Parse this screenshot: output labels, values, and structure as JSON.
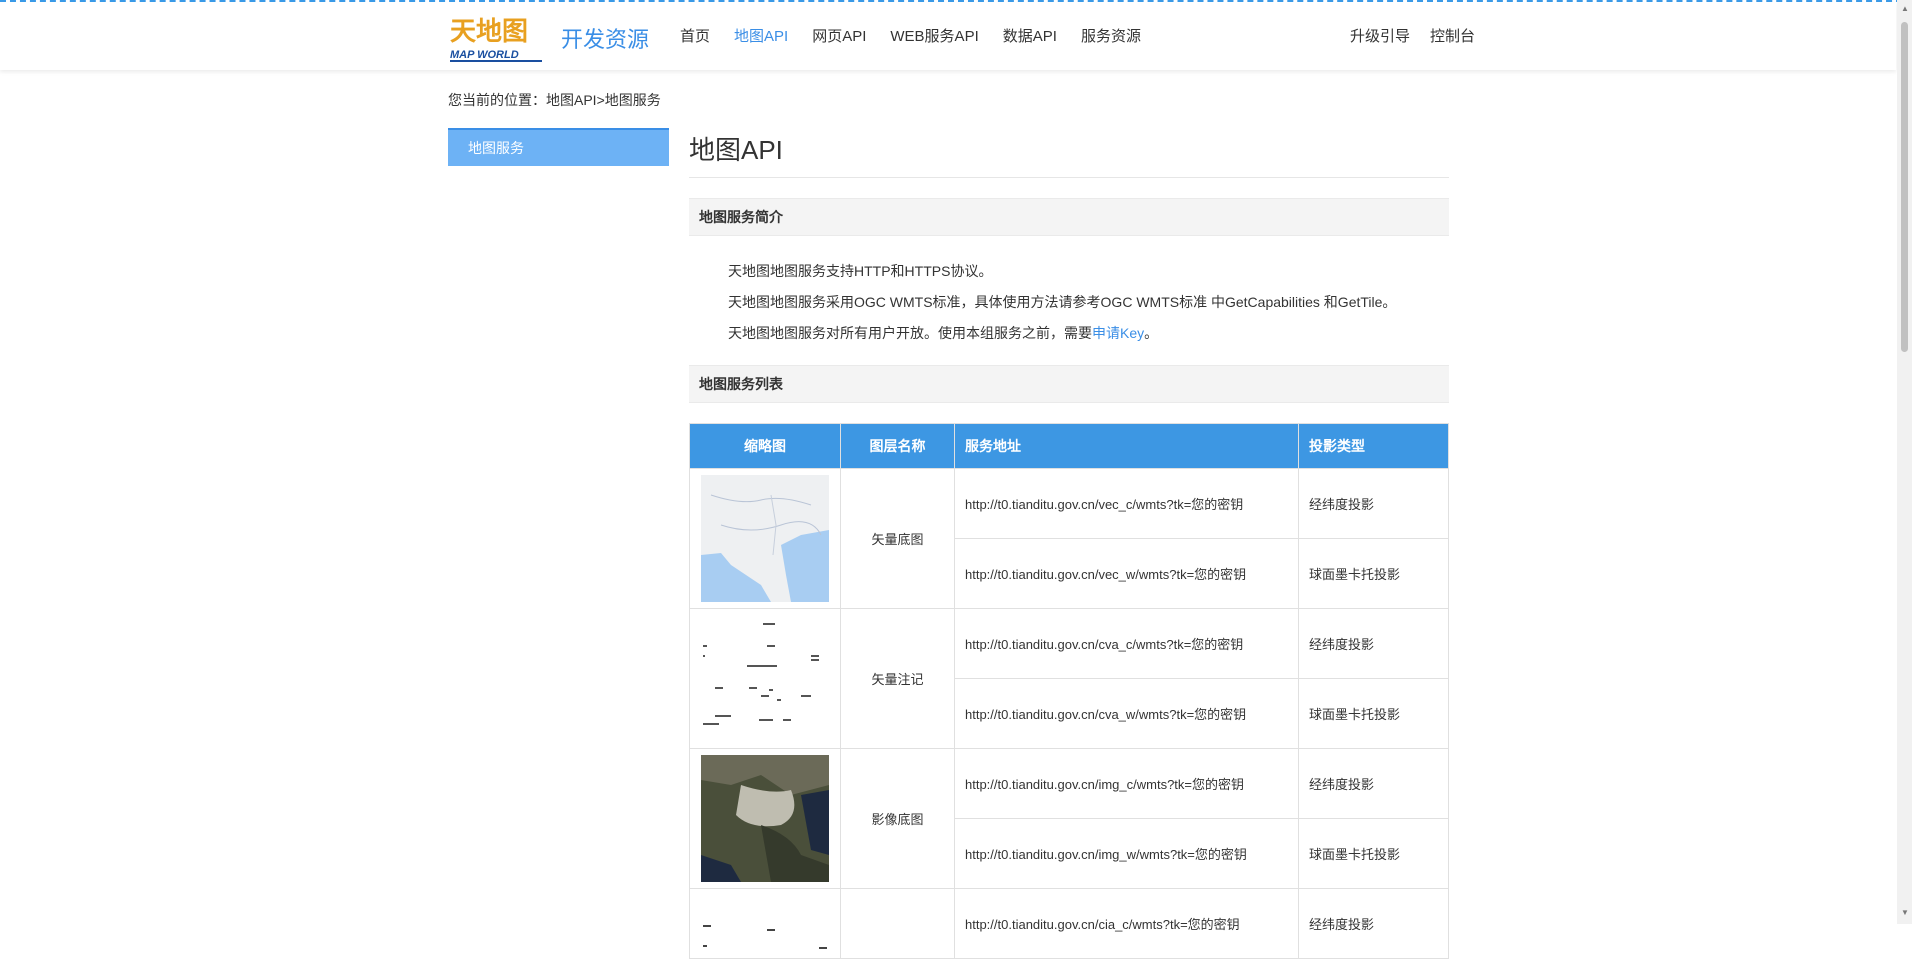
{
  "header": {
    "logo_text": "天地图",
    "logo_sub": "MAP WORLD",
    "brand": "开发资源",
    "nav": [
      "首页",
      "地图API",
      "网页API",
      "WEB服务API",
      "数据API",
      "服务资源"
    ],
    "nav_right": [
      "升级引导",
      "控制台"
    ]
  },
  "breadcrumb": "您当前的位置：地图API>地图服务",
  "sidebar": {
    "item": "地图服务"
  },
  "main": {
    "title": "地图API",
    "section1": "地图服务简介",
    "intro": [
      "天地图地图服务支持HTTP和HTTPS协议。",
      "天地图地图服务采用OGC WMTS标准，具体使用方法请参考OGC WMTS标准 中GetCapabilities 和GetTile。"
    ],
    "intro3_prefix": "天地图地图服务对所有用户开放。使用本组服务之前，需要",
    "intro3_link": "申请Key",
    "intro3_suffix": "。",
    "section2": "地图服务列表",
    "table": {
      "headers": [
        "缩略图",
        "图层名称",
        "服务地址",
        "投影类型"
      ],
      "rows": [
        {
          "layer": "矢量底图",
          "urls": [
            "http://t0.tianditu.gov.cn/vec_c/wmts?tk=您的密钥",
            "http://t0.tianditu.gov.cn/vec_w/wmts?tk=您的密钥"
          ],
          "proj": [
            "经纬度投影",
            "球面墨卡托投影"
          ]
        },
        {
          "layer": "矢量注记",
          "urls": [
            "http://t0.tianditu.gov.cn/cva_c/wmts?tk=您的密钥",
            "http://t0.tianditu.gov.cn/cva_w/wmts?tk=您的密钥"
          ],
          "proj": [
            "经纬度投影",
            "球面墨卡托投影"
          ]
        },
        {
          "layer": "影像底图",
          "urls": [
            "http://t0.tianditu.gov.cn/img_c/wmts?tk=您的密钥",
            "http://t0.tianditu.gov.cn/img_w/wmts?tk=您的密钥"
          ],
          "proj": [
            "经纬度投影",
            "球面墨卡托投影"
          ]
        },
        {
          "layer": "",
          "urls": [
            "http://t0.tianditu.gov.cn/cia_c/wmts?tk=您的密钥"
          ],
          "proj": [
            "经纬度投影"
          ]
        }
      ]
    }
  }
}
